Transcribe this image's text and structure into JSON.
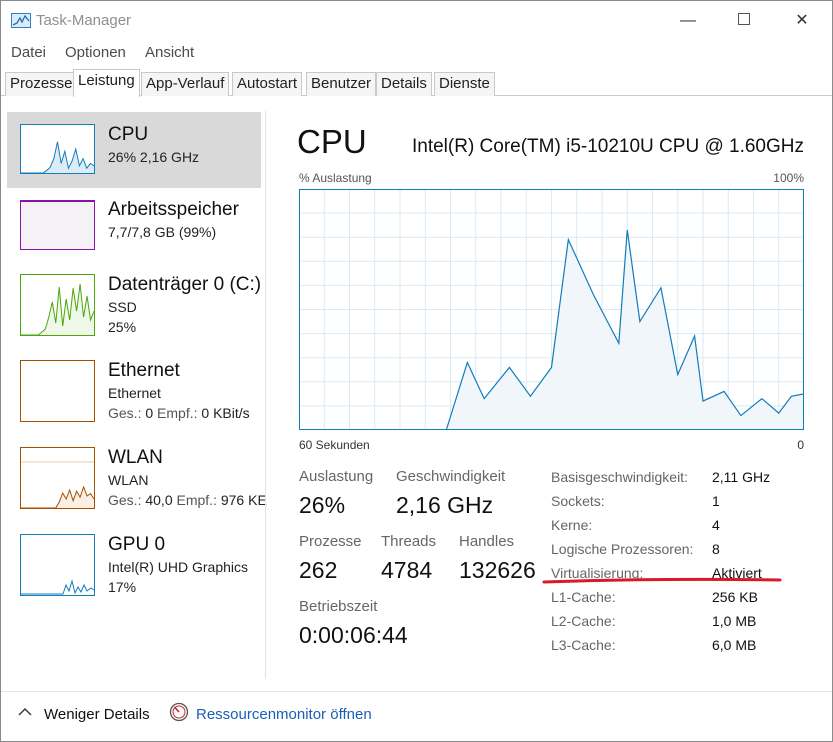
{
  "window": {
    "title": "Task-Manager",
    "controls": {
      "minimize": "—",
      "close": "✕"
    }
  },
  "menu": [
    "Datei",
    "Optionen",
    "Ansicht"
  ],
  "tabs": [
    {
      "label": "Prozesse",
      "active": false
    },
    {
      "label": "Leistung",
      "active": true
    },
    {
      "label": "App-Verlauf",
      "active": false
    },
    {
      "label": "Autostart",
      "active": false
    },
    {
      "label": "Benutzer",
      "active": false
    },
    {
      "label": "Details",
      "active": false
    },
    {
      "label": "Dienste",
      "active": false
    }
  ],
  "sidebar": {
    "items": [
      {
        "title": "CPU",
        "line1": "26%  2,16 GHz",
        "selected": true,
        "color": "#117dbb"
      },
      {
        "title": "Arbeitsspeicher",
        "line1": "7,7/7,8 GB (99%)",
        "color": "#8b12ae"
      },
      {
        "title": "Datenträger 0 (C:)",
        "line1": "SSD",
        "line2": "25%",
        "color": "#4da60c"
      },
      {
        "title": "Ethernet",
        "line1": "Ethernet",
        "line2_label_send": "Ges.:",
        "line2_send": "0",
        "line2_label_recv": "Empf.:",
        "line2_recv": "0 KBit/s",
        "color": "#a74f01"
      },
      {
        "title": "WLAN",
        "line1": "WLAN",
        "line2_label_send": "Ges.:",
        "line2_send": "40,0",
        "line2_label_recv": "Empf.:",
        "line2_recv": "976 KE",
        "color": "#a74f01"
      },
      {
        "title": "GPU 0",
        "line1": "Intel(R) UHD Graphics",
        "line2": "17%",
        "color": "#117dbb"
      }
    ],
    "sparklines": {
      "cpu": [
        0,
        0,
        0,
        0,
        0,
        0,
        0,
        5,
        12,
        30,
        65,
        20,
        45,
        10,
        25,
        50,
        15,
        30,
        10,
        20,
        15
      ],
      "memory": [
        99,
        99,
        99,
        99,
        99,
        99,
        99,
        99,
        99,
        99,
        99,
        99,
        99,
        99,
        99
      ],
      "disk": [
        0,
        0,
        0,
        0,
        0,
        0,
        5,
        10,
        30,
        55,
        20,
        80,
        15,
        60,
        25,
        78,
        40,
        85,
        30,
        65,
        25,
        40
      ],
      "wlan": [
        0,
        0,
        0,
        0,
        0,
        0,
        0,
        0,
        0,
        0,
        0,
        10,
        25,
        15,
        30,
        12,
        28,
        18,
        35,
        20,
        24,
        15
      ]
    }
  },
  "main": {
    "title": "CPU",
    "cpu_name": "Intel(R) Core(TM) i5-10210U CPU @ 1.60GHz",
    "axis_top_left": "% Auslastung",
    "axis_top_right": "100%",
    "axis_bottom_left": "60 Sekunden",
    "axis_bottom_right": "0",
    "chart_data": {
      "type": "area",
      "xlabel": "60 Sekunden",
      "ylabel": "% Auslastung",
      "ylim": [
        0,
        100
      ],
      "xlim": [
        60,
        0
      ],
      "grid": true,
      "x": [
        60,
        42.5,
        40,
        38,
        35,
        32.5,
        30,
        28,
        25,
        22,
        21,
        19.5,
        17,
        15,
        13,
        12,
        9.5,
        7.5,
        5,
        3,
        1.5,
        0
      ],
      "values": [
        0,
        0,
        28,
        13,
        26,
        14,
        26,
        79,
        56,
        36,
        83,
        45,
        59,
        23,
        39,
        12,
        16,
        6,
        13,
        7,
        14,
        15
      ]
    },
    "stats": {
      "auslastung_label": "Auslastung",
      "auslastung_value": "26%",
      "geschwindigkeit_label": "Geschwindigkeit",
      "geschwindigkeit_value": "2,16 GHz",
      "prozesse_label": "Prozesse",
      "prozesse_value": "262",
      "threads_label": "Threads",
      "threads_value": "4784",
      "handles_label": "Handles",
      "handles_value": "132626",
      "betriebszeit_label": "Betriebszeit",
      "betriebszeit_value": "0:00:06:44"
    },
    "info": [
      {
        "label": "Basisgeschwindigkeit:",
        "value": "2,11 GHz"
      },
      {
        "label": "Sockets:",
        "value": "1"
      },
      {
        "label": "Kerne:",
        "value": "4"
      },
      {
        "label": "Logische Prozessoren:",
        "value": "8"
      },
      {
        "label": "Virtualisierung:",
        "value": "Aktiviert"
      },
      {
        "label": "L1-Cache:",
        "value": "256 KB"
      },
      {
        "label": "L2-Cache:",
        "value": "1,0 MB"
      },
      {
        "label": "L3-Cache:",
        "value": "6,0 MB"
      }
    ]
  },
  "footer": {
    "fewer_details": "Weniger Details",
    "resource_monitor": "Ressourcenmonitor öffnen"
  },
  "colors": {
    "cpu_line": "#117dbb",
    "cpu_fill": "#f1f6fa",
    "grid": "#d9eaf4",
    "annotation_red": "#d8192a",
    "link": "#1a5fb4"
  }
}
